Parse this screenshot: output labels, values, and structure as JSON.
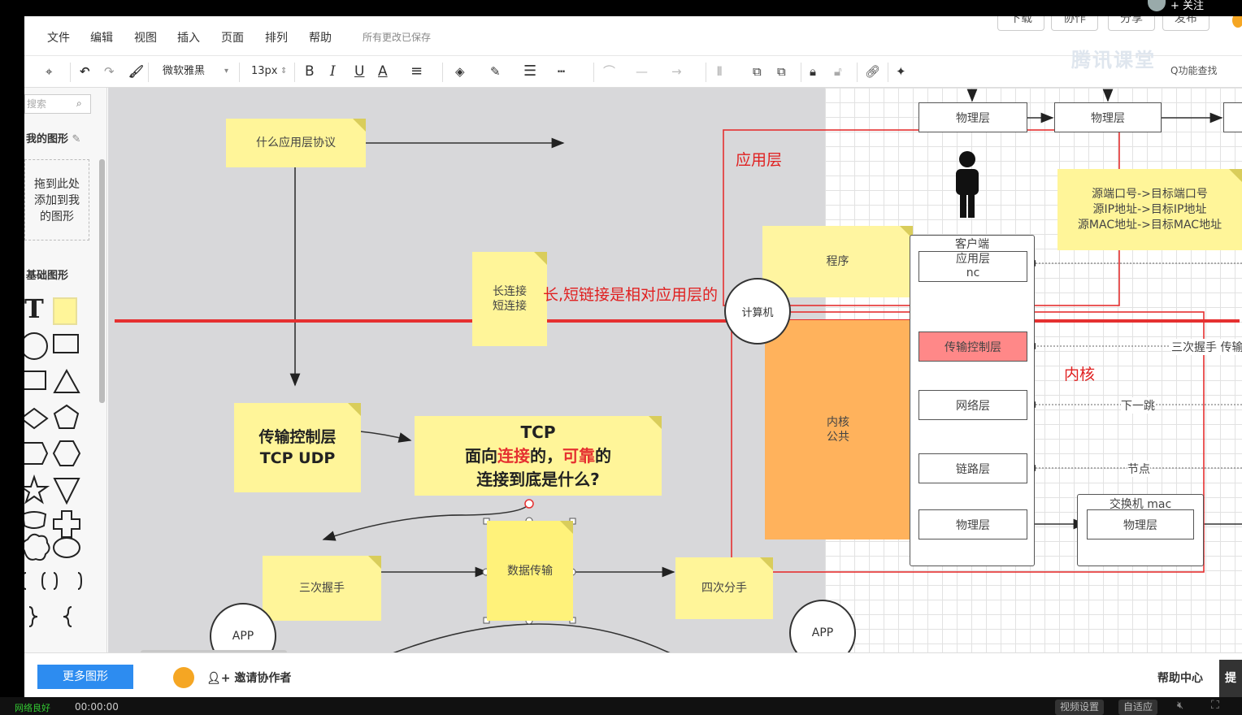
{
  "top_right": {
    "follow": "+ 关注"
  },
  "menu": {
    "items": [
      "文件",
      "编辑",
      "视图",
      "插入",
      "页面",
      "排列",
      "帮助"
    ],
    "save_status": "所有更改已保存",
    "tabs": [
      "下载",
      "协作",
      "分享",
      "发布"
    ]
  },
  "toolbar": {
    "font_name": "微软雅黑",
    "font_size": "13px",
    "bold": "B",
    "italic": "I",
    "underline": "U",
    "font_color": "A"
  },
  "brand": {
    "name": "腾讯课堂"
  },
  "function_search": "Q功能查找",
  "left_panel": {
    "search_placeholder": "搜索",
    "my_shapes": "我的图形",
    "drop_hint_1": "拖到此处",
    "drop_hint_2": "添加到我",
    "drop_hint_3": "的图形",
    "basic_shapes": "基础图形"
  },
  "diagram": {
    "what_protocol": "什么应用层协议",
    "long_conn": "长连接",
    "short_conn": "短连接",
    "transport_title": "传输控制层",
    "transport_sub": "TCP UDP",
    "tcp_title": "TCP",
    "tcp_line2_a": "面向",
    "tcp_line2_b": "连接",
    "tcp_line2_c": "的，",
    "tcp_line2_d": "可靠",
    "tcp_line2_e": "的",
    "tcp_line3": "连接到底是什么?",
    "handshake3": "三次握手",
    "data_transfer": "数据传输",
    "handshake4": "四次分手",
    "app_left": "APP",
    "app_right": "APP",
    "annotation_red": "长,短链接是相对应用层的",
    "label_app_layer": "应用层",
    "label_kernel": "内核",
    "program": "程序",
    "computer": "计算机",
    "kernel_public_1": "内核",
    "kernel_public_2": "公共",
    "phys_top_1": "物理层",
    "phys_top_2": "物理层",
    "info_1": "源端口号->目标端口号",
    "info_2": "源IP地址->目标IP地址",
    "info_3": "源MAC地址->目标MAC地址",
    "client": "客户端",
    "app_layer_box_1": "应用层",
    "app_layer_box_2": "nc",
    "transport_box": "传输控制层",
    "network_box": "网络层",
    "link_box": "链路层",
    "phys_box": "物理层",
    "switch": "交换机  mac",
    "switch_phys": "物理层",
    "edge_handshake": "三次握手 传输",
    "edge_nexthop": "下一跳",
    "edge_node": "节点"
  },
  "bottom": {
    "more_shapes": "更多图形",
    "invite": "邀请协作者",
    "help_center": "帮助中心",
    "tip": "提"
  },
  "player": {
    "network": "网络良好",
    "time": "00:00:00",
    "video_settings": "视频设置",
    "auto_fit": "自适应"
  }
}
